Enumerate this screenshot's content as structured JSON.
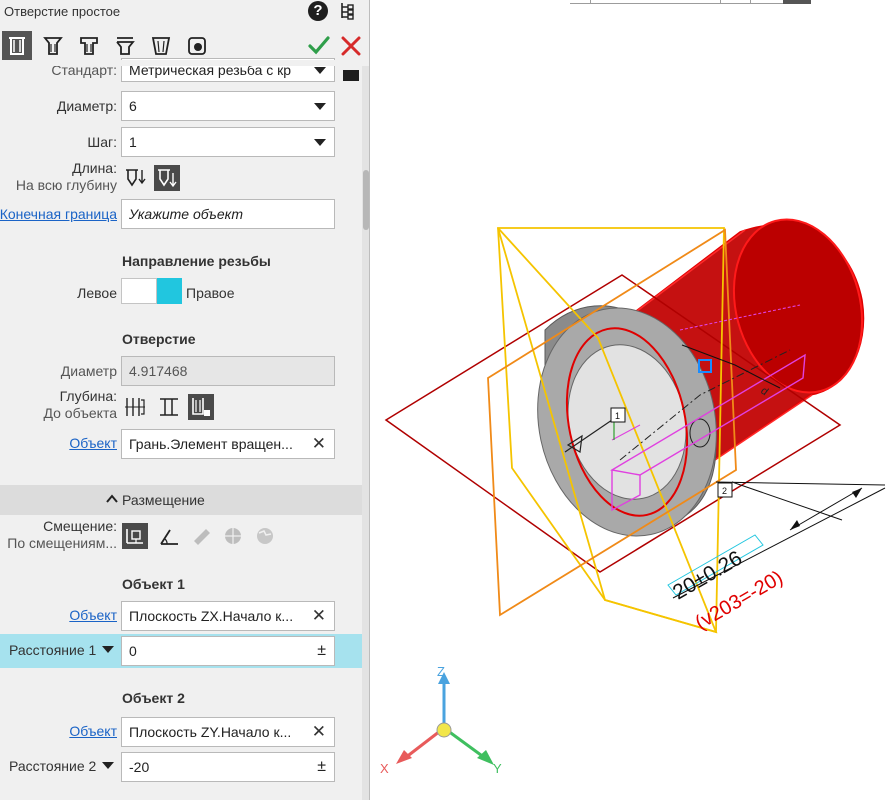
{
  "header": {
    "title": "Отверстие простое",
    "help_icon": "?",
    "tree_icon": "tree-icon",
    "ok_icon": "check-icon",
    "cancel_icon": "close-icon",
    "hole_types": [
      "simple-hole-icon",
      "countersink-hole-icon",
      "counterbore-hole-icon",
      "stepped-hole-icon",
      "cone-hole-icon",
      "special-hole-icon"
    ]
  },
  "params": {
    "standard": {
      "label": "Стандарт:",
      "value": "Метрическая резьба с кр"
    },
    "diameter": {
      "label": "Диаметр:",
      "value": "6"
    },
    "pitch": {
      "label": "Шаг:",
      "value": "1"
    },
    "length": {
      "label": "Длина:",
      "sub": "На всю глубину"
    },
    "end_bound": {
      "label": "Конечная граница",
      "placeholder": "Укажите объект"
    }
  },
  "thread_dir": {
    "heading": "Направление резьбы",
    "left": "Левое",
    "right": "Правое",
    "selected": "right",
    "accent": "#21c6df"
  },
  "hole": {
    "heading": "Отверстие",
    "diameter_label": "Диаметр",
    "diameter_value": "4.917468",
    "depth_label": "Глубина:",
    "depth_sub": "До объекта",
    "object_label": "Объект",
    "object_value": "Грань.Элемент вращен..."
  },
  "placement": {
    "section_title": "Размещение",
    "offset_label": "Смещение:",
    "offset_sub": "По смещениям...",
    "obj1_heading": "Объект 1",
    "obj1_label": "Объект",
    "obj1_value": "Плоскость ZX.Начало к...",
    "dist1_label": "Расстояние 1",
    "dist1_value": "0",
    "obj2_heading": "Объект 2",
    "obj2_label": "Объект",
    "obj2_value": "Плоскость ZY.Начало к...",
    "dist2_label": "Расстояние 2",
    "dist2_value": "-20",
    "pm": "±"
  },
  "viewport": {
    "dimension_text": "20±0.26",
    "variable_text": "(v203=-20)",
    "point1": "1",
    "point2": "2",
    "axis_x": "X",
    "axis_y": "Y",
    "axis_z": "Z",
    "dim_letters": "d"
  }
}
